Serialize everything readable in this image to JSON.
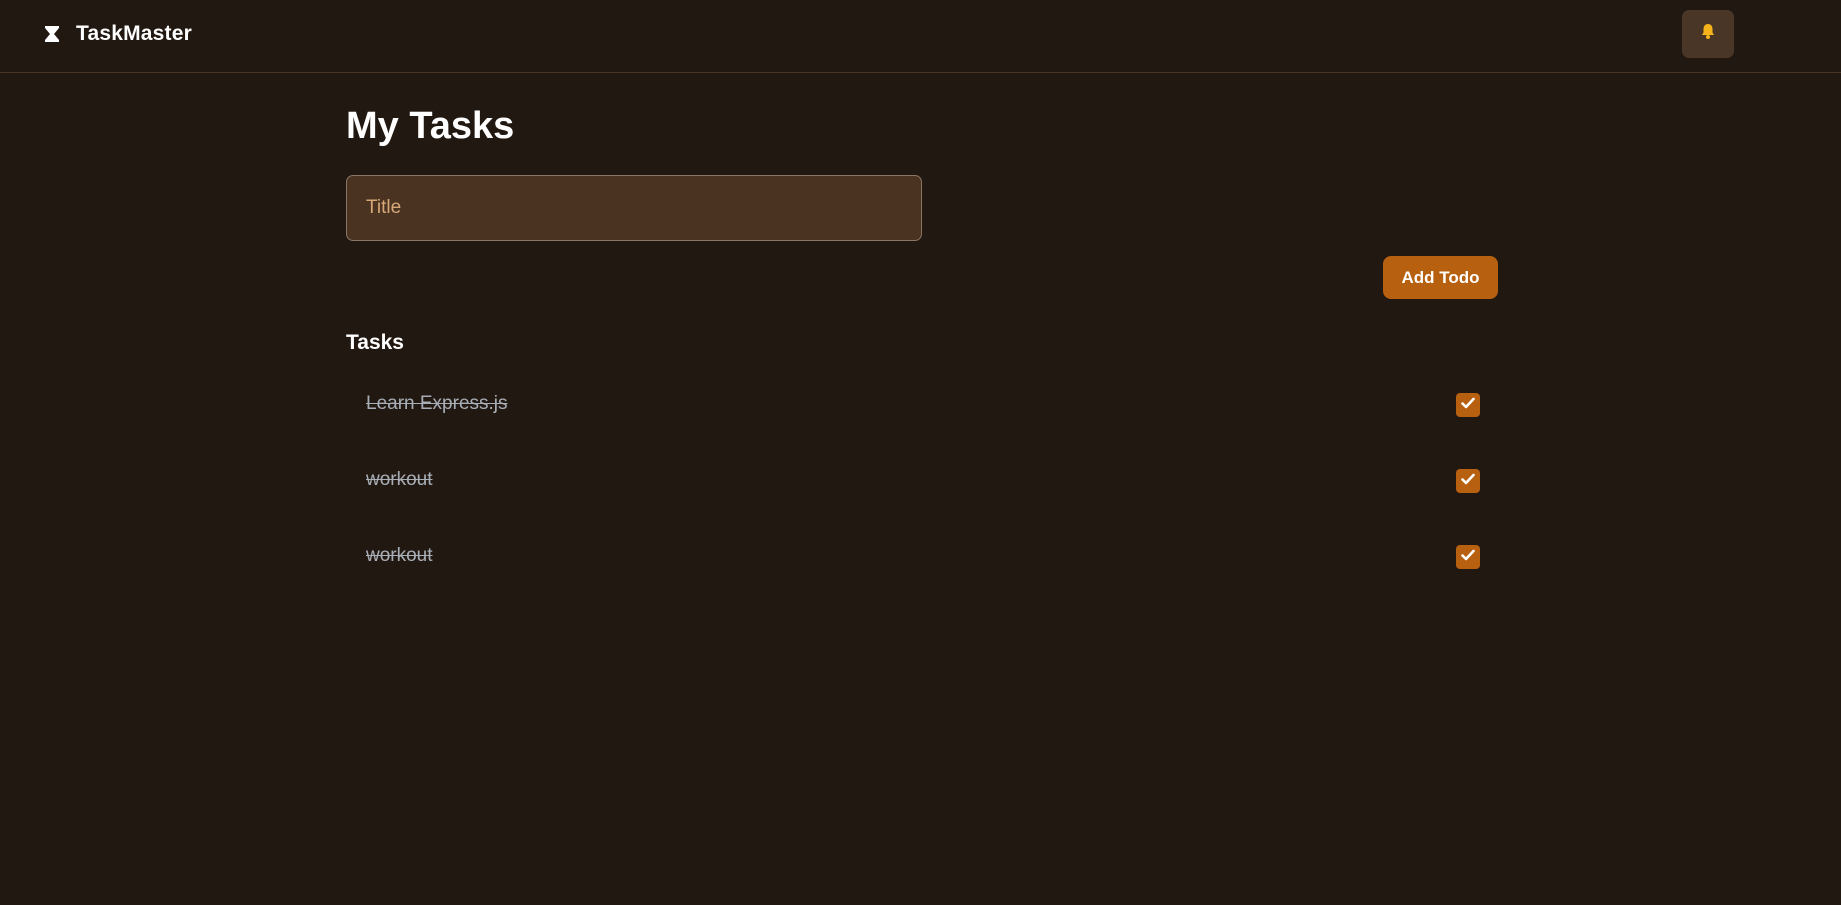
{
  "app": {
    "name": "TaskMaster",
    "logo_icon": "hourglass-icon",
    "notification_icon": "bell-icon"
  },
  "main": {
    "title": "My Tasks",
    "input": {
      "placeholder": "Title",
      "value": ""
    },
    "add_button_label": "Add Todo",
    "section_title": "Tasks"
  },
  "tasks": [
    {
      "label": "Learn Express.js",
      "completed": true
    },
    {
      "label": "workout",
      "completed": true
    },
    {
      "label": "workout",
      "completed": true
    }
  ],
  "colors": {
    "background": "#221812",
    "accent": "#b7600f",
    "input_bg": "#4a3321",
    "bell": "#f4b41a",
    "completed_text": "#a8aeb6"
  }
}
